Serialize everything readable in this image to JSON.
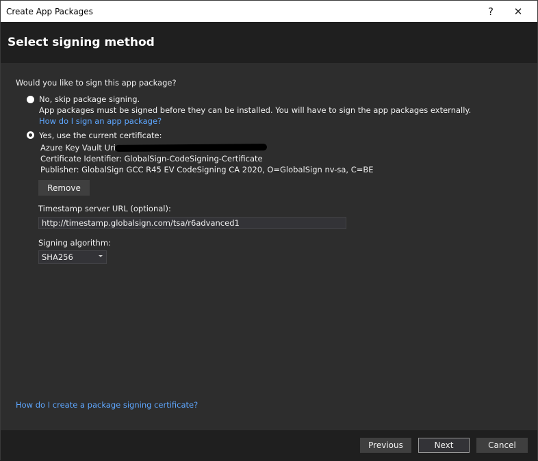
{
  "window": {
    "title": "Create App Packages",
    "help_label": "?",
    "close_label": "✕"
  },
  "header": {
    "title": "Select signing method"
  },
  "main": {
    "question": "Would you like to sign this app package?",
    "option_no": {
      "label": "No, skip package signing.",
      "description": "App packages must be signed before they can be installed. You will have to sign the app packages externally.",
      "link": "How do I sign an app package?",
      "selected": false
    },
    "option_yes": {
      "label": "Yes, use the current certificate:",
      "selected": true
    },
    "certificate": {
      "vault_uri_label": "Azure Key Vault Uri:",
      "identifier": "Certificate Identifier: GlobalSign-CodeSigning-Certificate",
      "publisher": "Publisher: GlobalSign GCC R45 EV CodeSigning CA 2020, O=GlobalSign nv-sa, C=BE"
    },
    "remove_label": "Remove",
    "timestamp_label": "Timestamp server URL (optional):",
    "timestamp_value": "http://timestamp.globalsign.com/tsa/r6advanced1",
    "algorithm_label": "Signing algorithm:",
    "algorithm_value": "SHA256",
    "cert_help_link": "How do I create a package signing certificate?"
  },
  "footer": {
    "previous": "Previous",
    "next": "Next",
    "cancel": "Cancel"
  }
}
